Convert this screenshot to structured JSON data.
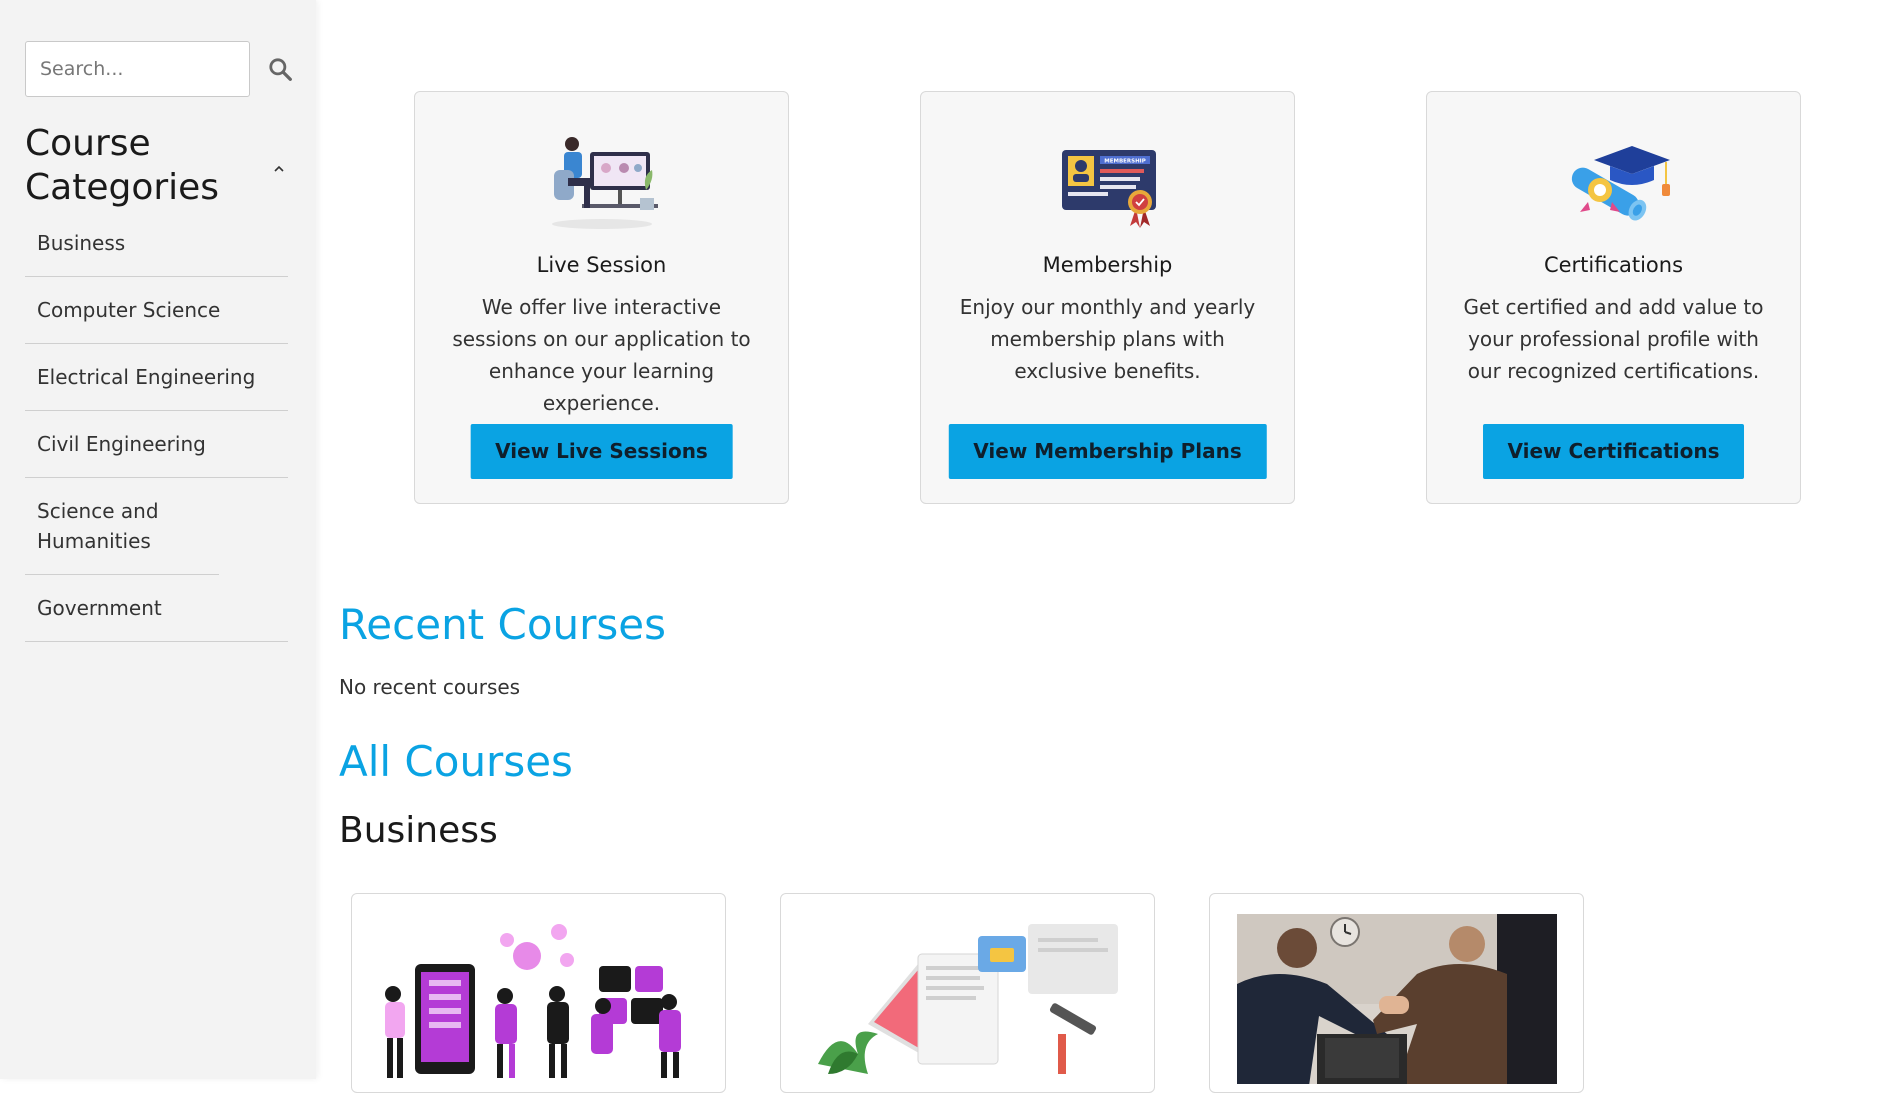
{
  "sidebar": {
    "search": {
      "placeholder": "Search..."
    },
    "categories_title": "Course Categories",
    "categories": [
      {
        "label": "Business"
      },
      {
        "label": "Computer Science"
      },
      {
        "label": "Electrical Engineering"
      },
      {
        "label": "Civil Engineering"
      },
      {
        "label": "Science and Humanities"
      },
      {
        "label": "Government"
      }
    ]
  },
  "features": [
    {
      "icon": "live-session-illustration",
      "title": "Live Session",
      "description": "We offer live interactive sessions on our application to enhance your learning experience.",
      "button": "View Live Sessions"
    },
    {
      "icon": "membership-card-illustration",
      "badge_text": "MEMBERSHIP",
      "title": "Membership",
      "description": "Enjoy our monthly and yearly membership plans with exclusive benefits.",
      "button": "View Membership Plans"
    },
    {
      "icon": "graduation-certificate-illustration",
      "title": "Certifications",
      "description": "Get certified and add value to your professional profile with our recognized certifications.",
      "button": "View Certifications"
    }
  ],
  "recent": {
    "heading": "Recent Courses",
    "empty_text": "No recent courses"
  },
  "all_courses": {
    "heading": "All Courses",
    "category_heading": "Business",
    "courses": [
      {
        "thumb": "team-collaboration-illustration"
      },
      {
        "thumb": "laptop-documents-illustration"
      },
      {
        "thumb": "business-handshake-photo"
      }
    ]
  },
  "colors": {
    "accent": "#0aa3e3",
    "sidebar_bg": "#f3f3f3",
    "card_bg": "#f7f7f7"
  }
}
